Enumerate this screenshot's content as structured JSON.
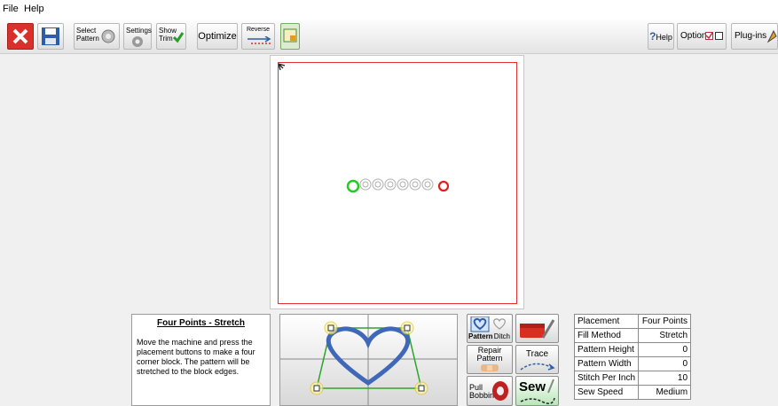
{
  "menu": {
    "file": "File",
    "help": "Help"
  },
  "toolbar": {
    "select_pattern": "Select Pattern",
    "settings": "Settings",
    "show_trim": "Show Trim",
    "optimize": "Optimize",
    "reverse": "Reverse",
    "help": "Help",
    "options": "Options",
    "plugins": "Plug-ins"
  },
  "info": {
    "title": "Four Points - Stretch",
    "text": "Move the machine and press the placement buttons to make a four corner block. The pattern will be stretched to the block edges."
  },
  "actions": {
    "pattern": "Pattern",
    "ditch": "Ditch",
    "repair_pattern": "Repair Pattern",
    "trace": "Trace",
    "pull_bobbin": "Pull Bobbin",
    "sew": "Sew"
  },
  "properties": [
    {
      "label": "Placement",
      "value": "Four Points"
    },
    {
      "label": "Fill Method",
      "value": "Stretch"
    },
    {
      "label": "Pattern Height",
      "value": "0"
    },
    {
      "label": "Pattern Width",
      "value": "0"
    },
    {
      "label": "Stitch Per Inch",
      "value": "10"
    },
    {
      "label": "Sew Speed",
      "value": "Medium"
    }
  ],
  "colors": {
    "start_marker": "#22cc22",
    "end_marker": "#e02020",
    "frame": "#e03030",
    "heart": "#3f68b8",
    "quad": "#2aa52a"
  }
}
